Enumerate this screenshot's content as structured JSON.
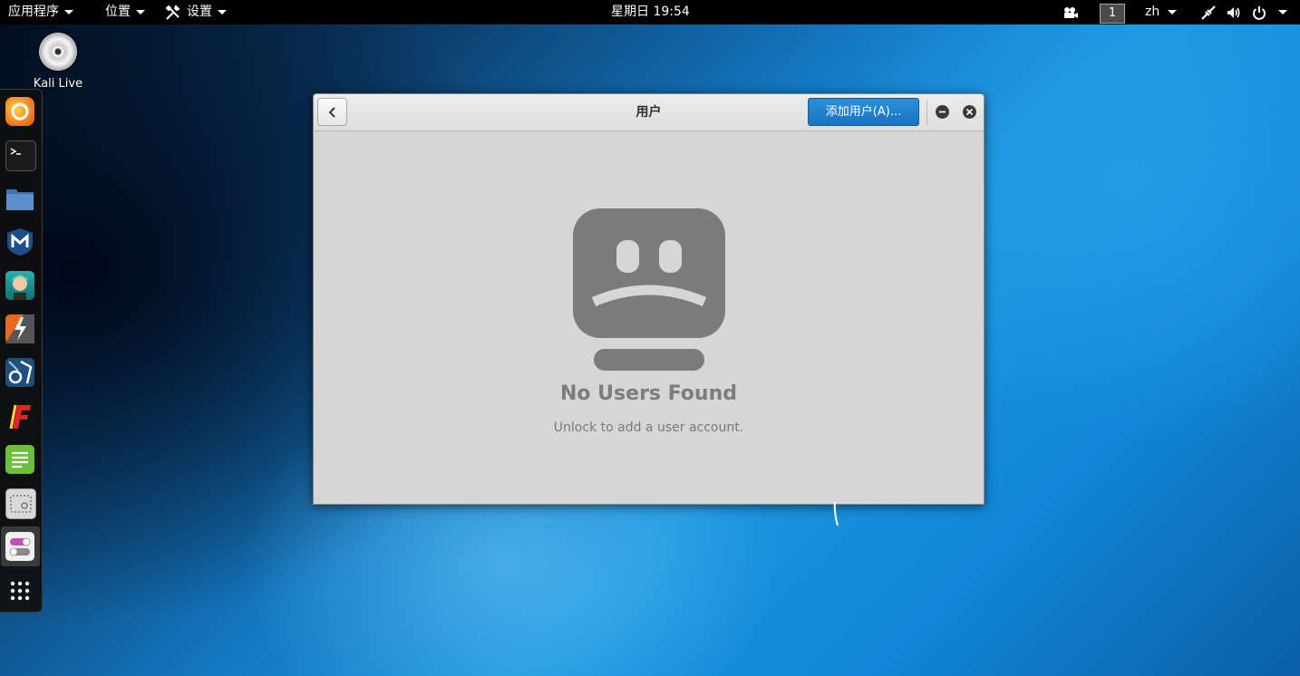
{
  "topbar": {
    "applications": "应用程序",
    "places": "位置",
    "settings": "设置",
    "clock": "星期日 19:54",
    "workspace": "1",
    "language": "zh"
  },
  "desktop": {
    "icon_label": "Kali Live"
  },
  "dock": {
    "apps": [
      "firefox",
      "terminal",
      "files",
      "metasploit",
      "armitage",
      "burpsuite",
      "maltego",
      "faraday",
      "text-editor",
      "screenshot",
      "settings-tweaks"
    ]
  },
  "window": {
    "title": "用户",
    "add_user_label": "添加用户(A)...",
    "empty_title": "No Users Found",
    "empty_subtitle": "Unlock to add a user account."
  },
  "colors": {
    "accent": "#1f7dc8",
    "window_bg": "#d6d6d6",
    "sad_face": "#7b7b7b"
  }
}
